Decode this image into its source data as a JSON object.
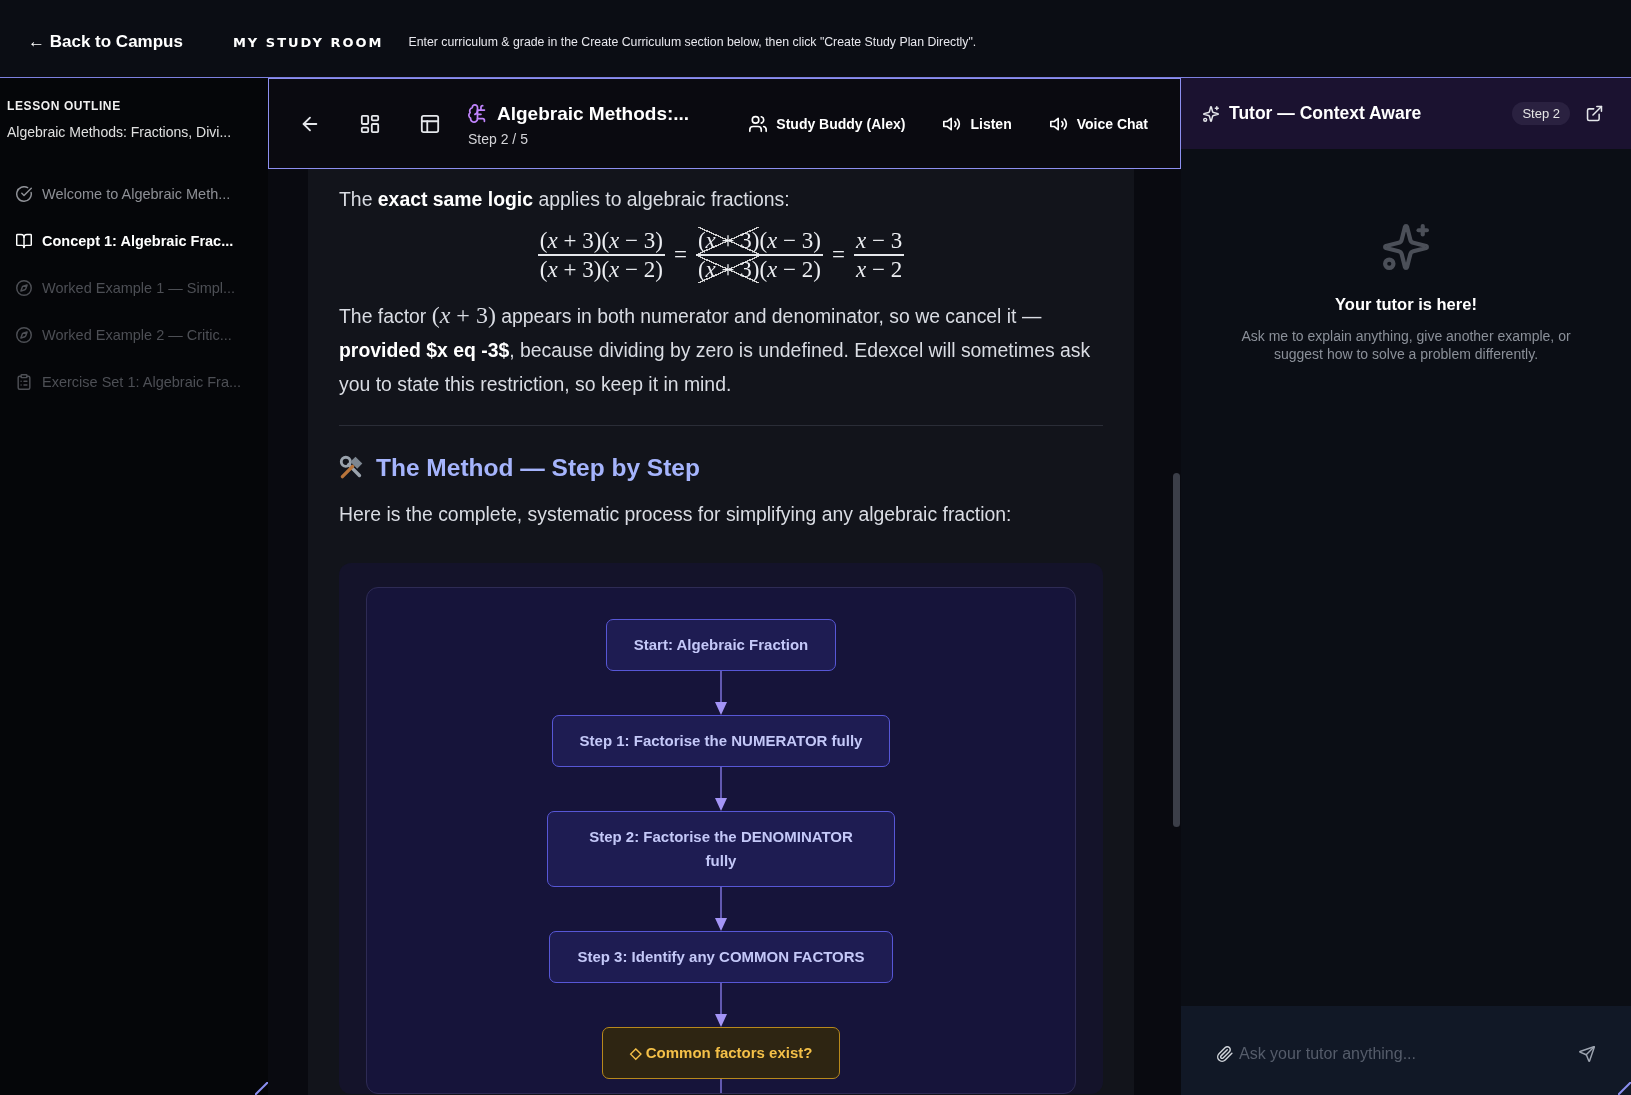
{
  "top_bar": {
    "back_link": "← Back to Campus",
    "title": "MY STUDY ROOM",
    "hint": "Enter curriculum & grade in the Create Curriculum section below, then click \"Create Study Plan Directly\"."
  },
  "sidebar": {
    "heading": "LESSON OUTLINE",
    "subtitle": "Algebraic Methods: Fractions, Divi...",
    "items": [
      {
        "label": "Welcome to Algebraic Meth...",
        "kind": "intro",
        "selected": false,
        "completed": true
      },
      {
        "label": "Concept 1: Algebraic Frac...",
        "kind": "concept",
        "selected": true,
        "completed": false
      },
      {
        "label": "Worked Example 1 — Simpl...",
        "kind": "example",
        "selected": false,
        "completed": false
      },
      {
        "label": "Worked Example 2 — Critic...",
        "kind": "example",
        "selected": false,
        "completed": false
      },
      {
        "label": "Exercise Set 1: Algebraic Fra...",
        "kind": "exercise",
        "selected": false,
        "completed": false
      }
    ]
  },
  "toolbar": {
    "title": "Algebraic Methods:...",
    "step": "Step 2 / 5",
    "buttons": [
      {
        "label": "Study Buddy (Alex)",
        "kind": "buddy"
      },
      {
        "label": "Listen",
        "kind": "audio"
      },
      {
        "label": "Voice Chat",
        "kind": "audio"
      }
    ]
  },
  "lesson": {
    "blocks": [
      {
        "kind": "paragraph",
        "parts": [
          {
            "kind": "text",
            "text": "The **exact same logic** applies to algebraic fractions:"
          }
        ]
      },
      {
        "kind": "equation",
        "terms": [
          {
            "kind": "fraction",
            "numerator": [
              {
                "text": "(*x* + 3)(*x* − 3)",
                "cancelled": false
              }
            ],
            "denominator": [
              {
                "text": "(*x* + 3)(*x* − 2)",
                "cancelled": false
              }
            ]
          },
          {
            "kind": "symbol",
            "text": "="
          },
          {
            "kind": "fraction",
            "numerator": [
              {
                "text": "(*x* + 3)",
                "cancelled": true
              },
              {
                "text": "(*x* − 3)",
                "cancelled": false
              }
            ],
            "denominator": [
              {
                "text": "(*x* + 3)",
                "cancelled": true
              },
              {
                "text": "(*x* − 2)",
                "cancelled": false
              }
            ]
          },
          {
            "kind": "symbol",
            "text": "="
          },
          {
            "kind": "fraction",
            "numerator": [
              {
                "text": "*x* − 3",
                "cancelled": false
              }
            ],
            "denominator": [
              {
                "text": "*x* − 2",
                "cancelled": false
              }
            ]
          }
        ]
      },
      {
        "kind": "paragraph",
        "parts": [
          {
            "kind": "text",
            "text": "The factor "
          },
          {
            "kind": "math",
            "text": "(*x* + 3)"
          },
          {
            "kind": "text",
            "text": " appears in both numerator and denominator, so we cancel it — **provided $x eq -3$**, because dividing by zero is undefined. Edexcel will sometimes ask you to state this restriction, so keep it in mind."
          }
        ]
      },
      {
        "kind": "divider"
      },
      {
        "kind": "heading",
        "text": "The Method — Step by Step"
      },
      {
        "kind": "paragraph",
        "parts": [
          {
            "kind": "text",
            "text": "Here is the complete, systematic process for simplifying any algebraic fraction:"
          }
        ]
      },
      {
        "kind": "flowchart",
        "nodes": [
          {
            "label": "Start: Algebraic Fraction",
            "kind": "process"
          },
          {
            "label": "Step 1: Factorise the NUMERATOR fully",
            "kind": "process"
          },
          {
            "label": "Step 2: Factorise the DENOMINATOR fully",
            "kind": "process"
          },
          {
            "label": "Step 3: Identify any COMMON FACTORS",
            "kind": "process"
          },
          {
            "label": "◇ Common factors exist?",
            "kind": "decision"
          }
        ]
      }
    ]
  },
  "tutor": {
    "title": "Tutor — Context Aware",
    "step_badge": "Step 2",
    "empty_title": "Your tutor is here!",
    "empty_text": "Ask me to explain anything, give another example, or suggest how to solve a problem differently.",
    "input": {
      "placeholder": "Ask your tutor anything..."
    }
  }
}
